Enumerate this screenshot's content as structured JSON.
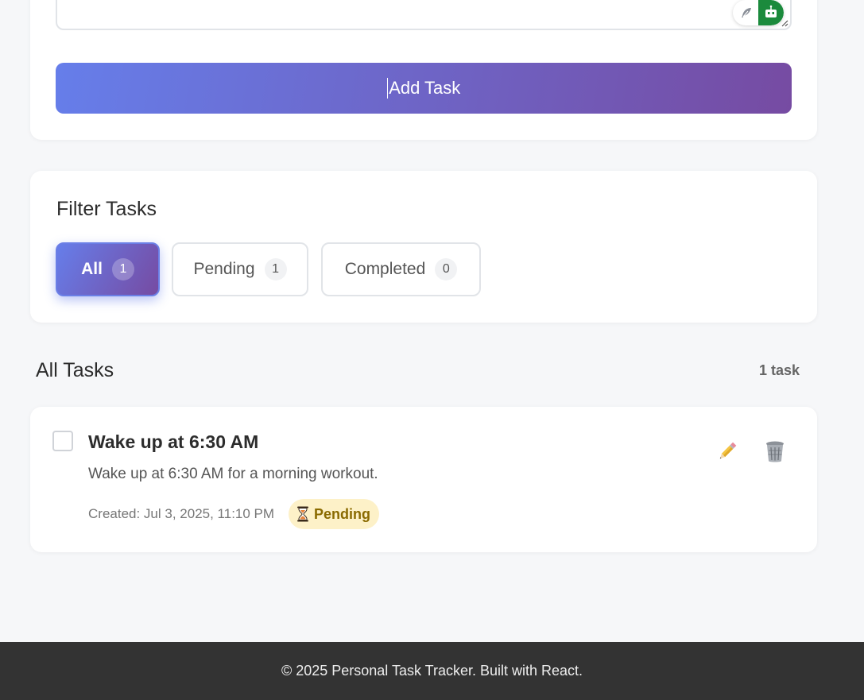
{
  "add_form": {
    "submit_label": "Add Task"
  },
  "filter": {
    "title": "Filter Tasks",
    "buttons": [
      {
        "label": "All",
        "count": "1",
        "active": true
      },
      {
        "label": "Pending",
        "count": "1",
        "active": false
      },
      {
        "label": "Completed",
        "count": "0",
        "active": false
      }
    ]
  },
  "tasks": {
    "heading": "All Tasks",
    "count_label": "1 task",
    "items": [
      {
        "title": "Wake up at 6:30 AM",
        "description": "Wake up at 6:30 AM for a morning workout.",
        "created": "Created: Jul 3, 2025, 11:10 PM",
        "status": "Pending",
        "status_icon": "hourglass-icon",
        "completed": false
      }
    ]
  },
  "footer": {
    "text": "© 2025 Personal Task Tracker. Built with React."
  },
  "colors": {
    "accent_start": "#667eea",
    "accent_end": "#764ba2",
    "pending_bg": "#fdf1c8",
    "pending_text": "#8a6a00",
    "footer_bg": "#333333",
    "page_bg": "#f6f7f9"
  }
}
